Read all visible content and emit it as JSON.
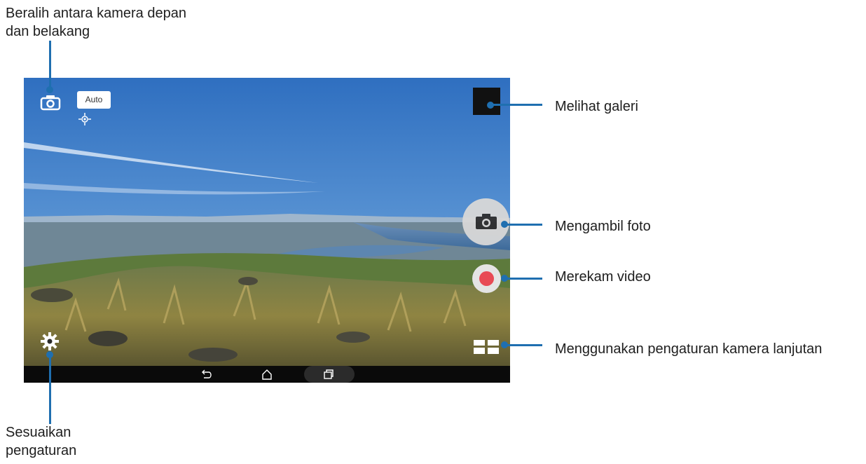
{
  "callouts": {
    "switch_camera": {
      "line1": "Beralih antara kamera depan",
      "line2": "dan belakang"
    },
    "gallery": "Melihat galeri",
    "take_photo": "Mengambil foto",
    "record_video": "Merekam video",
    "advanced_settings": "Menggunakan pengaturan kamera lanjutan",
    "adjust_settings": {
      "line1": "Sesuaikan",
      "line2": "pengaturan"
    }
  },
  "camera": {
    "mode_badge": "Auto"
  },
  "colors": {
    "callout_line": "#1f6fb0",
    "record_dot": "#e84a55",
    "nav_bar": "#0a0a0a"
  },
  "icons": {
    "switch_camera": "camera-switch-icon",
    "focus": "focus-target-icon",
    "gallery": "gallery-thumbnail",
    "shutter": "camera-icon",
    "record": "record-dot-icon",
    "advanced": "grid-modes-icon",
    "settings": "gear-icon",
    "nav_back": "back-icon",
    "nav_home": "home-icon",
    "nav_recents": "recents-icon"
  }
}
